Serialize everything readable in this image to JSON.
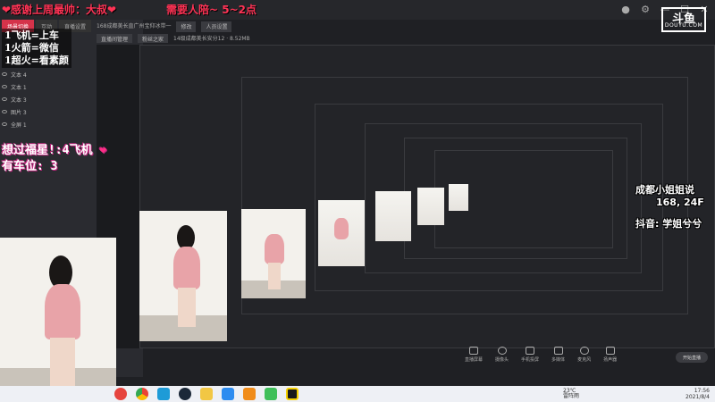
{
  "overlay": {
    "thanks": "❤感谢上周最帅：大叔❤",
    "need": "需要人陪~  5~2点",
    "rules": [
      "1飞机=上车",
      "1火箭=微信",
      "1超火=看素颜"
    ],
    "wish_line1": "想过福星!:4飞机",
    "wish_heart": "❤",
    "wish_line2": "有车位: 3"
  },
  "profile": {
    "name": "成都小姐姐说",
    "stats": "168, 24F",
    "douyin": "抖音: 学姐兮兮"
  },
  "app": {
    "logo": "斗鱼",
    "logo_sub": "DOUYU.COM",
    "tabs": [
      "场景切换",
      "互动",
      "直播设置"
    ],
    "room_title": "168成都美长直广州宝仰冰带一",
    "edit_label": "修改",
    "fans_label": "人员设置",
    "info_pills": [
      "直播间管理",
      "粉丝之家",
      "14级成都美长安分12 · 8.52MB"
    ],
    "layers": [
      {
        "name": "文本 4"
      },
      {
        "name": "文本 1"
      },
      {
        "name": "文本 3"
      },
      {
        "name": "图片 3"
      },
      {
        "name": "全屏 1"
      }
    ],
    "tools": [
      "直播屏幕",
      "摄像头",
      "手机投屏",
      "多媒体",
      "麦克风",
      "扬声器"
    ],
    "start_button": "开始直播"
  },
  "taskbar": {
    "weather": "23℃",
    "weather_sub": "雷阵雨",
    "time": "17:56",
    "date": "2021/8/4"
  },
  "colors": {
    "accent": "#d5334a",
    "overlay_red": "#ff3355",
    "heart": "#ff2f86",
    "taskbar": "#eef0f5"
  }
}
